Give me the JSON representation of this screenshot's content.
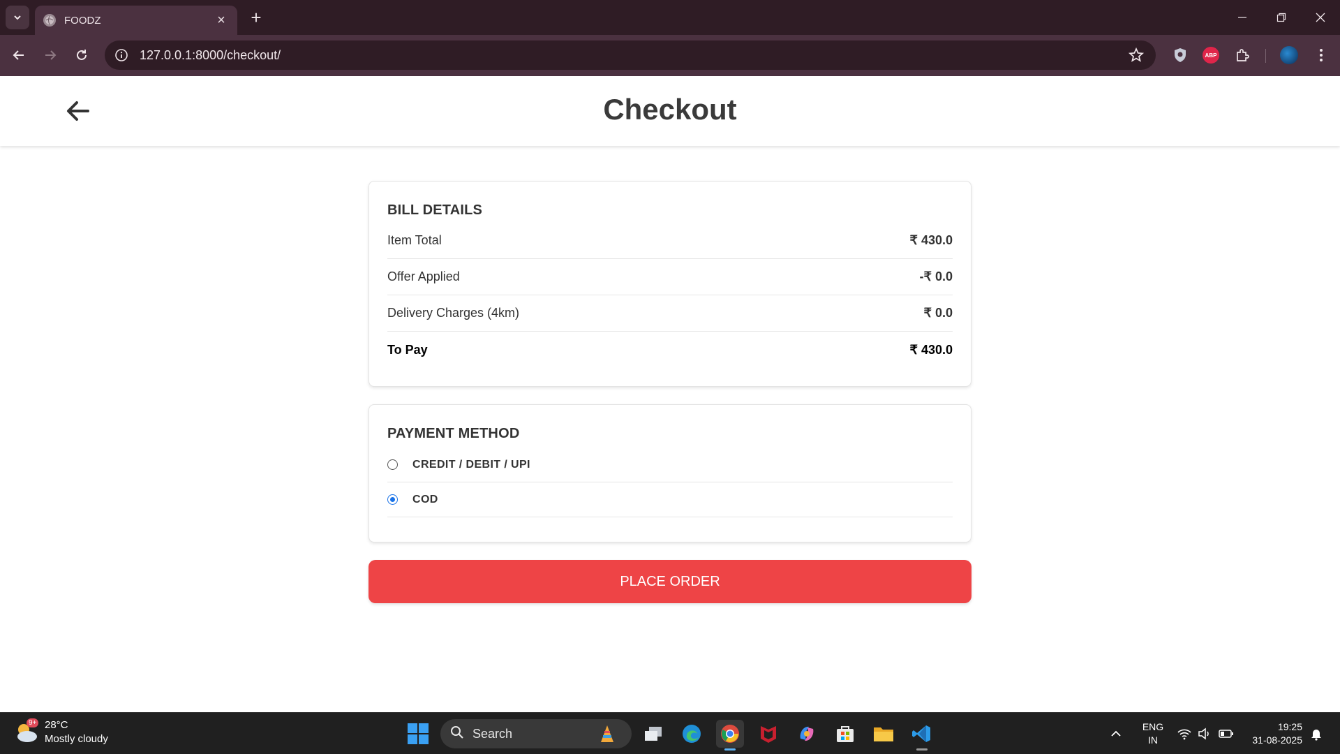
{
  "browser": {
    "tab_title": "FOODZ",
    "url": "127.0.0.1:8000/checkout/",
    "icons": [
      "tab-search-icon",
      "globe-icon",
      "close-icon",
      "plus-icon",
      "minimize-icon",
      "restore-icon",
      "window-close-icon",
      "back-icon",
      "forward-icon",
      "reload-icon",
      "info-icon",
      "star-icon",
      "shield-icon",
      "abp-icon",
      "extensions-icon",
      "profile-avatar",
      "more-icon"
    ],
    "abp_label": "ABP"
  },
  "header": {
    "title": "Checkout"
  },
  "bill": {
    "heading": "BILL DETAILS",
    "rows": [
      {
        "label": "Item Total",
        "amount": "₹ 430.0"
      },
      {
        "label": "Offer Applied",
        "amount": "-₹ 0.0"
      },
      {
        "label": "Delivery Charges (4km)",
        "amount": "₹ 0.0"
      },
      {
        "label": "To Pay",
        "amount": "₹ 430.0"
      }
    ]
  },
  "payment": {
    "heading": "PAYMENT METHOD",
    "options": [
      {
        "label": "CREDIT / DEBIT / UPI",
        "selected": false
      },
      {
        "label": "COD",
        "selected": true
      }
    ]
  },
  "actions": {
    "place_order": "PLACE ORDER"
  },
  "taskbar": {
    "weather_temp": "28°C",
    "weather_desc": "Mostly cloudy",
    "weather_badge": "9+",
    "search_label": "Search",
    "lang_line1": "ENG",
    "lang_line2": "IN",
    "time": "19:25",
    "date": "31-08-2025"
  },
  "colors": {
    "accent_red": "#ee4446",
    "radio_blue": "#1a73e8",
    "chrome_dark": "#2f1c25",
    "chrome_toolbar": "#4b3140"
  }
}
